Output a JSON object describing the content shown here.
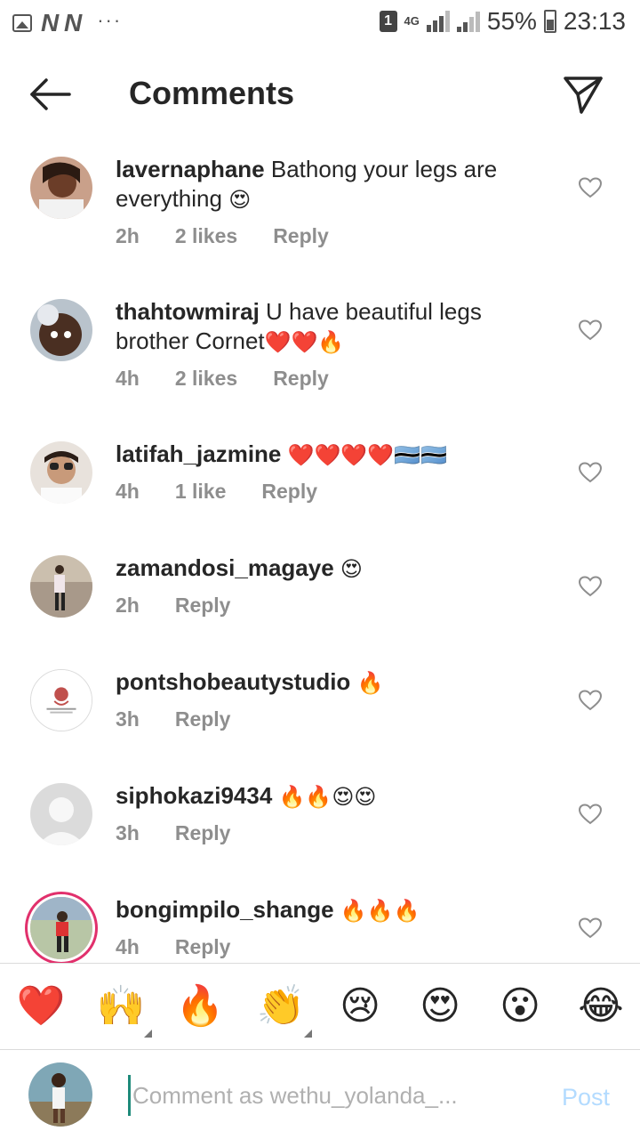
{
  "status_bar": {
    "n_icons": "N N",
    "dots": "···",
    "sim": "1",
    "network": "4G",
    "battery": "55%",
    "time": "23:13"
  },
  "header": {
    "title": "Comments",
    "back_icon": "back-arrow-icon",
    "send_icon": "paper-plane-icon"
  },
  "comments": [
    {
      "username": "lavernaphane",
      "text": "Bathong your legs are everything",
      "emoji": "😍",
      "time": "2h",
      "likes": "2 likes",
      "reply": "Reply"
    },
    {
      "username": "thahtowmiraj",
      "text": "U have beautiful legs brother Cornet",
      "emoji": "❤️❤️🔥",
      "time": "4h",
      "likes": "2 likes",
      "reply": "Reply"
    },
    {
      "username": "latifah_jazmine",
      "text": "",
      "emoji": "❤️❤️❤️❤️🇧🇼🇧🇼",
      "time": "4h",
      "likes": "1 like",
      "reply": "Reply"
    },
    {
      "username": "zamandosi_magaye",
      "text": "",
      "emoji": "😍",
      "time": "2h",
      "likes": "",
      "reply": "Reply"
    },
    {
      "username": "pontshobeautystudio",
      "text": "",
      "emoji": "🔥",
      "time": "3h",
      "likes": "",
      "reply": "Reply"
    },
    {
      "username": "siphokazi9434",
      "text": "",
      "emoji": "🔥🔥😍😍",
      "time": "3h",
      "likes": "",
      "reply": "Reply"
    },
    {
      "username": "bongimpilo_shange",
      "text": "",
      "emoji": "🔥🔥🔥",
      "time": "4h",
      "likes": "",
      "reply": "Reply"
    }
  ],
  "emoji_bar": [
    "❤️",
    "🙌",
    "🔥",
    "👏",
    "😢",
    "😍",
    "😮",
    "😂"
  ],
  "composer": {
    "placeholder": "Comment as wethu_yolanda_...",
    "post_label": "Post"
  },
  "colors": {
    "text": "#262626",
    "meta": "#8e8e8e",
    "post_disabled": "#b3dbff",
    "story_ring": "#e1306c"
  }
}
